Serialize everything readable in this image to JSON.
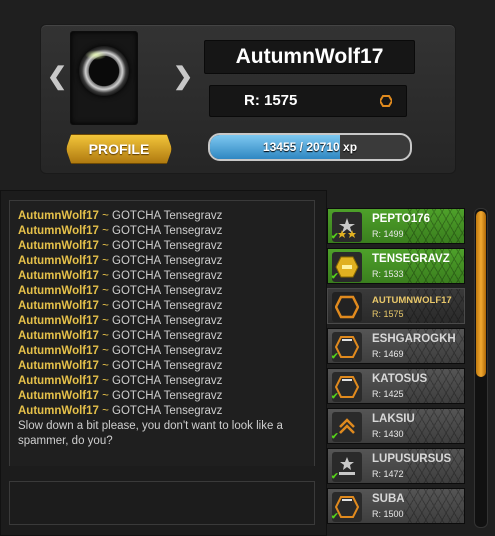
{
  "profile": {
    "username": "AutumnWolf17",
    "rating_text": "R: 1575",
    "xp_text": "13455 / 20710 xp",
    "xp_fraction": 0.6497,
    "profile_button": "PROFILE",
    "prev_arrow": "❮",
    "next_arrow": "❯"
  },
  "chat": {
    "messages": [
      {
        "author": "AutumnWolf17",
        "sep": " ~ ",
        "text": "GOTCHA Tensegravz"
      },
      {
        "author": "AutumnWolf17",
        "sep": " ~ ",
        "text": "GOTCHA Tensegravz"
      },
      {
        "author": "AutumnWolf17",
        "sep": " ~ ",
        "text": "GOTCHA Tensegravz"
      },
      {
        "author": "AutumnWolf17",
        "sep": " ~ ",
        "text": "GOTCHA Tensegravz"
      },
      {
        "author": "AutumnWolf17",
        "sep": " ~ ",
        "text": "GOTCHA Tensegravz"
      },
      {
        "author": "AutumnWolf17",
        "sep": " ~ ",
        "text": "GOTCHA Tensegravz"
      },
      {
        "author": "AutumnWolf17",
        "sep": " ~ ",
        "text": "GOTCHA Tensegravz"
      },
      {
        "author": "AutumnWolf17",
        "sep": " ~ ",
        "text": "GOTCHA Tensegravz"
      },
      {
        "author": "AutumnWolf17",
        "sep": " ~ ",
        "text": "GOTCHA Tensegravz"
      },
      {
        "author": "AutumnWolf17",
        "sep": " ~ ",
        "text": "GOTCHA Tensegravz"
      },
      {
        "author": "AutumnWolf17",
        "sep": " ~ ",
        "text": "GOTCHA Tensegravz"
      },
      {
        "author": "AutumnWolf17",
        "sep": " ~ ",
        "text": "GOTCHA Tensegravz"
      },
      {
        "author": "AutumnWolf17",
        "sep": " ~ ",
        "text": "GOTCHA Tensegravz"
      },
      {
        "author": "AutumnWolf17",
        "sep": " ~ ",
        "text": "GOTCHA Tensegravz"
      }
    ],
    "system_message": "Slow down a bit please, you don't want to look like a spammer, do you?",
    "input_value": ""
  },
  "players": [
    {
      "name": "PEPTO176",
      "rating": "R: 1499",
      "style": "green",
      "icon": "two-stars-rank-icon",
      "online": "✔"
    },
    {
      "name": "TENSEGRAVZ",
      "rating": "R: 1533",
      "style": "green",
      "icon": "gold-badge-rank-icon",
      "online": "✔"
    },
    {
      "name": "AUTUMNWOLF17",
      "rating": "R: 1575",
      "style": "self",
      "icon": "hexagon-rank-icon",
      "online": ""
    },
    {
      "name": "ESHGAROGKH",
      "rating": "R: 1469",
      "style": "gray",
      "icon": "hexagon-bar-rank-icon",
      "online": "✔"
    },
    {
      "name": "KATOSUS",
      "rating": "R: 1425",
      "style": "gray",
      "icon": "hexagon-bar-rank-icon",
      "online": "✔"
    },
    {
      "name": "LAKSIU",
      "rating": "R: 1430",
      "style": "gray",
      "icon": "chevron-rank-icon",
      "online": "✔"
    },
    {
      "name": "LUPUSURSUS",
      "rating": "R: 1472",
      "style": "gray",
      "icon": "stars-rank-icon",
      "online": "✔"
    },
    {
      "name": "SUBA",
      "rating": "R: 1500",
      "style": "gray",
      "icon": "hexagon-bar-rank-icon",
      "online": "✔"
    }
  ],
  "colors": {
    "accent_gold": "#e6c14a",
    "online_green": "#4ea12a",
    "xp_blue": "#2f87c2",
    "scroll_orange": "#f0a830"
  },
  "scroll": {
    "thumb_fraction": 0.52
  }
}
